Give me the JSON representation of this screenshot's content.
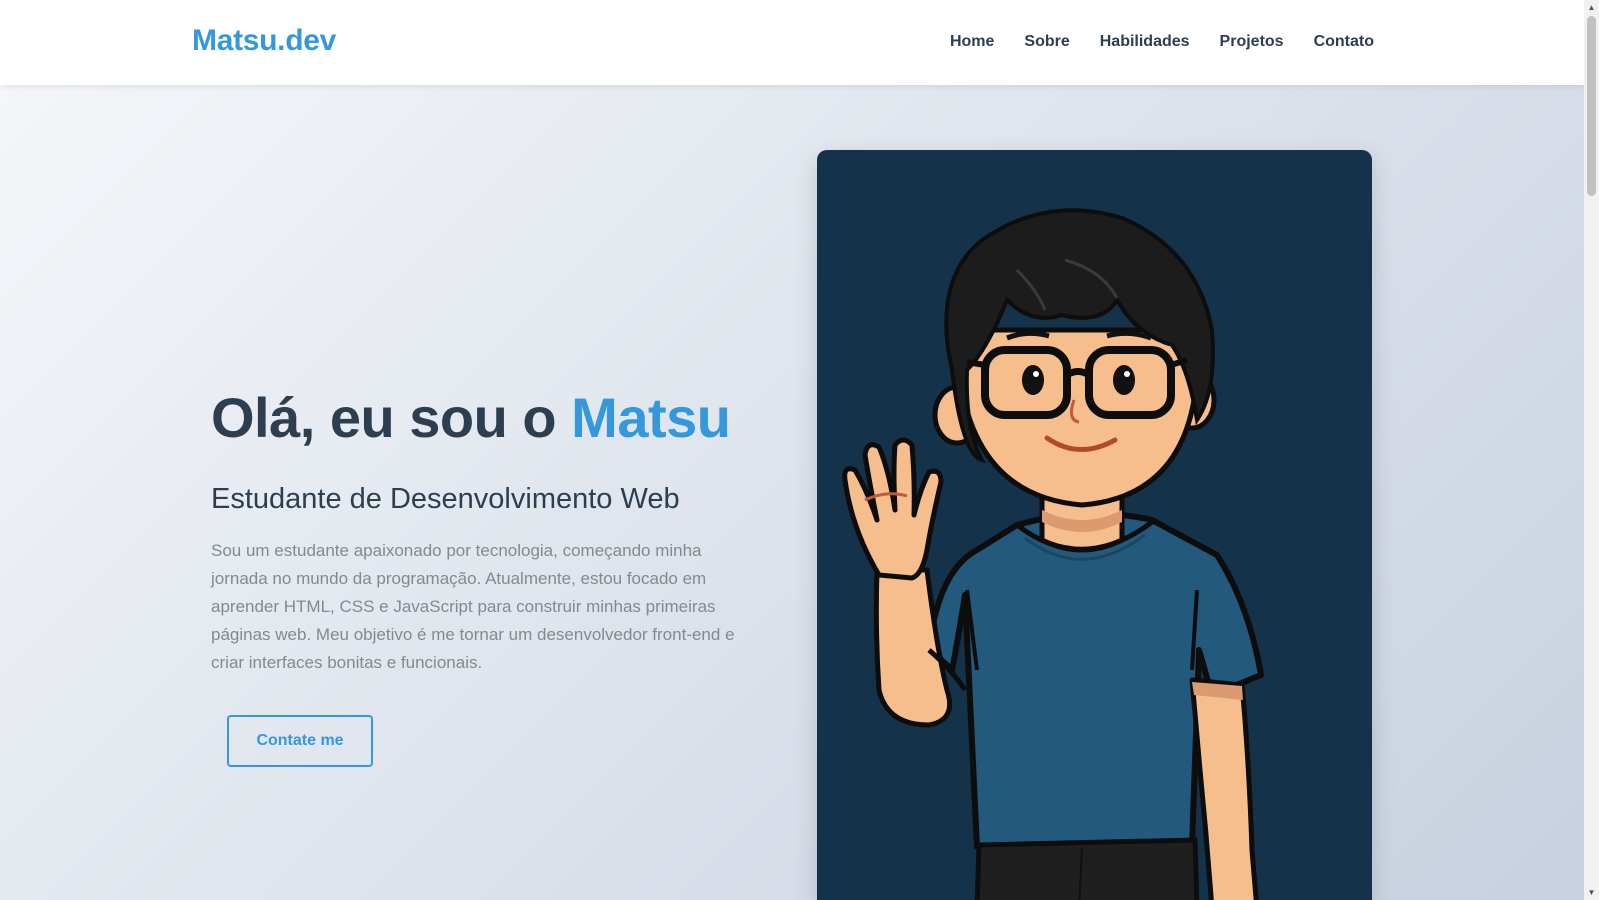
{
  "navbar": {
    "logo": "Matsu.dev",
    "links": [
      {
        "label": "Home"
      },
      {
        "label": "Sobre"
      },
      {
        "label": "Habilidades"
      },
      {
        "label": "Projetos"
      },
      {
        "label": "Contato"
      }
    ]
  },
  "hero": {
    "title_prefix": "Olá, eu sou o ",
    "title_name": "Matsu",
    "subtitle": "Estudante de Desenvolvimento Web",
    "description": "Sou um estudante apaixonado por tecnologia, começando minha jornada no mundo da programação. Atualmente, estou focado em aprender HTML, CSS e JavaScript para construir minhas primeiras páginas web. Meu objetivo é me tornar um desenvolvedor front-end e criar interfaces bonitas e funcionais.",
    "cta_label": "Contate me"
  },
  "colors": {
    "accent": "#3498db",
    "heading": "#2c3e50",
    "text_muted": "#7f8c8d",
    "card_bg": "#15324b"
  },
  "icons": {
    "scroll_up": "scroll-up-arrow-icon",
    "scroll_down": "scroll-down-arrow-icon"
  }
}
